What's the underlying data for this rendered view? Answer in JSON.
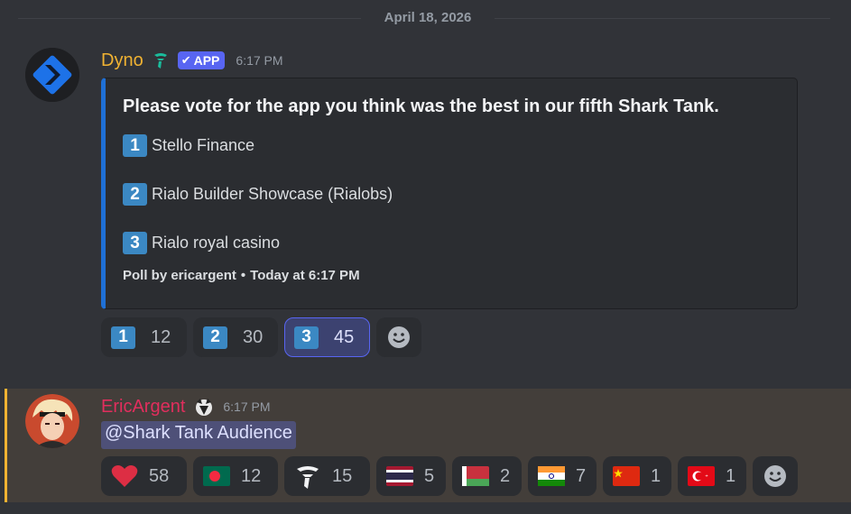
{
  "date_divider": "April 18, 2026",
  "messages": {
    "dyno": {
      "username": "Dyno",
      "badge": "APP",
      "timestamp": "6:17 PM",
      "embed": {
        "title": "Please vote for the app you think was the best in our fifth Shark Tank.",
        "options": [
          {
            "num": "1",
            "label": "Stello Finance"
          },
          {
            "num": "2",
            "label": "Rialo Builder Showcase (Rialobs)"
          },
          {
            "num": "3",
            "label": "Rialo royal casino"
          }
        ],
        "footer_author": "Poll by ericargent",
        "footer_time": "Today at 6:17 PM",
        "accent_color": "#1f70d6"
      },
      "reactions": [
        {
          "emoji": "keycap-1",
          "num": "1",
          "count": "12",
          "selected": false
        },
        {
          "emoji": "keycap-2",
          "num": "2",
          "count": "30",
          "selected": false
        },
        {
          "emoji": "keycap-3",
          "num": "3",
          "count": "45",
          "selected": true
        }
      ]
    },
    "eric": {
      "username": "EricArgent",
      "timestamp": "6:17 PM",
      "mention": "@Shark Tank Audience",
      "reactions": [
        {
          "emoji": "heart",
          "count": "58"
        },
        {
          "emoji": "flag-bangladesh",
          "count": "12"
        },
        {
          "emoji": "custom-hook-logo",
          "count": "15"
        },
        {
          "emoji": "flag-thailand",
          "count": "5"
        },
        {
          "emoji": "flag-belarus",
          "count": "2"
        },
        {
          "emoji": "flag-india",
          "count": "7"
        },
        {
          "emoji": "flag-china",
          "count": "1"
        },
        {
          "emoji": "flag-turkey",
          "count": "1"
        }
      ]
    }
  },
  "colors": {
    "background": "#313338",
    "dyno_name": "#f0b232",
    "eric_name": "#e12e5d",
    "app_badge": "#5865f2",
    "mention_highlight": "#433e3a"
  }
}
